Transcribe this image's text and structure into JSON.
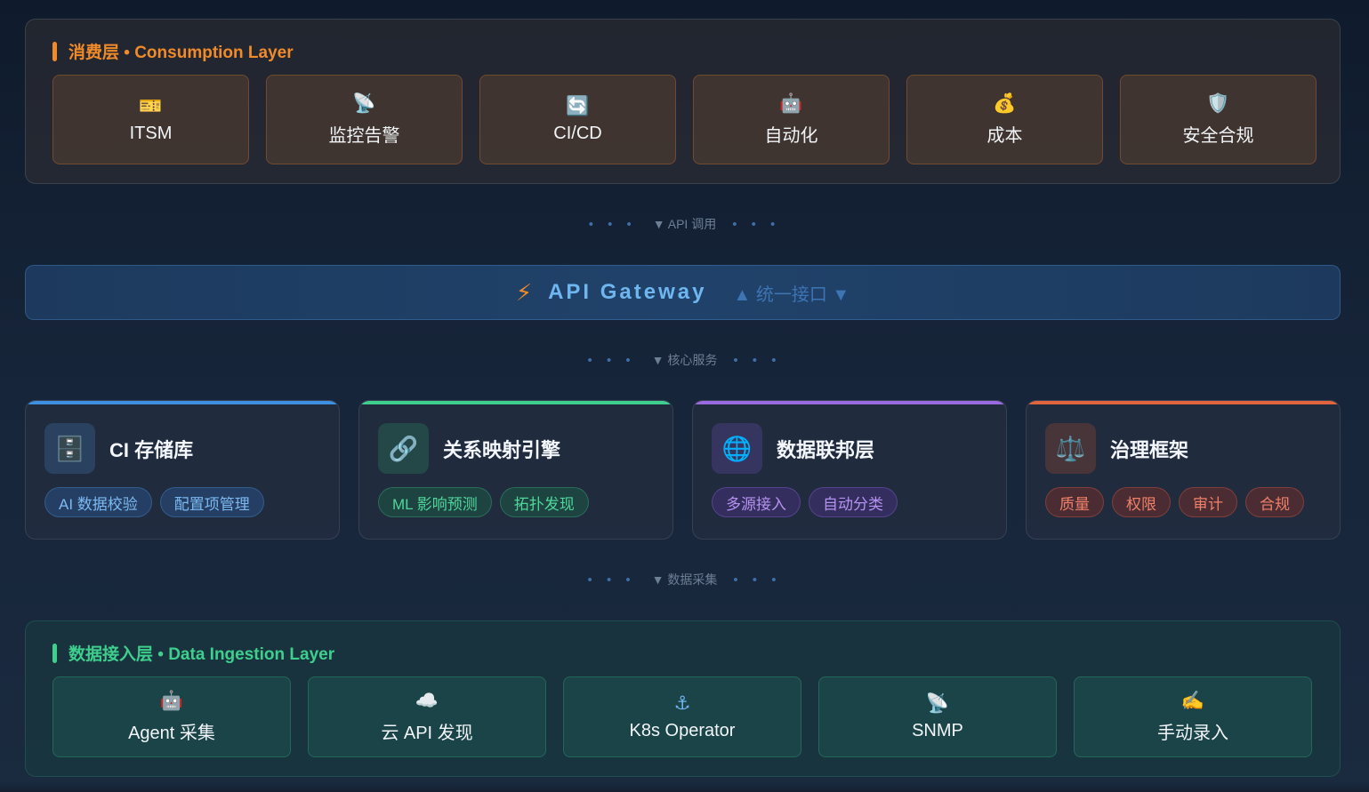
{
  "consumption": {
    "title": "消费层 • Consumption Layer",
    "color": "#f08a2a",
    "tiles": [
      {
        "icon": "🎫",
        "icon_name": "ticket-icon",
        "label": "ITSM"
      },
      {
        "icon": "📡",
        "icon_name": "satellite-antenna-icon",
        "label": "监控告警"
      },
      {
        "icon": "🔄",
        "icon_name": "refresh-icon",
        "label": "CI/CD"
      },
      {
        "icon": "🤖",
        "icon_name": "robot-icon",
        "label": "自动化"
      },
      {
        "icon": "💰",
        "icon_name": "money-bag-icon",
        "label": "成本"
      },
      {
        "icon": "🛡️",
        "icon_name": "shield-icon",
        "label": "安全合规"
      }
    ]
  },
  "connector_api": {
    "dots": "• • •",
    "label": "▼ API 调用"
  },
  "gateway": {
    "icon": "⚡",
    "title": "API Gateway",
    "subtitle": "▲ 统一接口 ▼"
  },
  "connector_core": {
    "dots": "• • •",
    "label": "▼ 核心服务"
  },
  "core_services": [
    {
      "title": "CI 存储库",
      "icon": "🗄️",
      "icon_name": "file-cabinet-icon",
      "accent": "#3f8fe0",
      "tags": [
        "AI 数据校验",
        "配置项管理"
      ]
    },
    {
      "title": "关系映射引擎",
      "icon": "🔗",
      "icon_name": "link-icon",
      "accent": "#3ecf8e",
      "tags": [
        "ML 影响预测",
        "拓扑发现"
      ]
    },
    {
      "title": "数据联邦层",
      "icon": "🌐",
      "icon_name": "globe-icon",
      "accent": "#9a6ae0",
      "tags": [
        "多源接入",
        "自动分类"
      ]
    },
    {
      "title": "治理框架",
      "icon": "⚖️",
      "icon_name": "scales-icon",
      "accent": "#e0643e",
      "tags": [
        "质量",
        "权限",
        "审计",
        "合规"
      ]
    }
  ],
  "connector_data": {
    "dots": "• • •",
    "label": "▼ 数据采集"
  },
  "ingestion": {
    "title": "数据接入层 • Data Ingestion Layer",
    "color": "#3ecf8e",
    "tiles": [
      {
        "icon": "🤖",
        "icon_name": "robot-icon",
        "label": "Agent 采集"
      },
      {
        "icon": "☁️",
        "icon_name": "cloud-icon",
        "label": "云 API 发现"
      },
      {
        "icon": "⚓",
        "icon_name": "anchor-icon",
        "label": "K8s Operator"
      },
      {
        "icon": "📡",
        "icon_name": "satellite-antenna-icon",
        "label": "SNMP"
      },
      {
        "icon": "✍️",
        "icon_name": "writing-hand-icon",
        "label": "手动录入"
      }
    ]
  }
}
